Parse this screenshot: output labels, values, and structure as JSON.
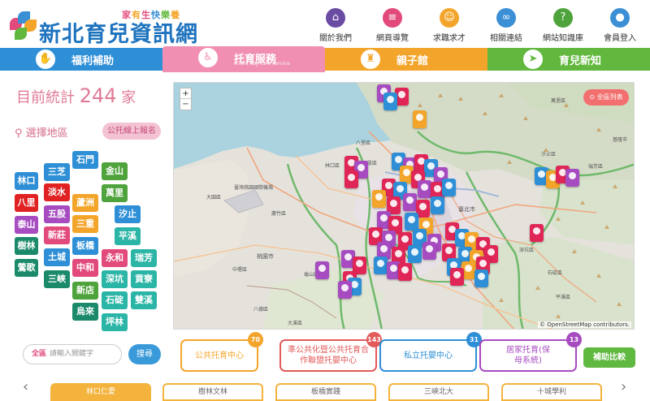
{
  "logo": {
    "title": "新北育兒資訊網",
    "tagline": [
      "家",
      "有",
      "生",
      "快",
      "樂",
      "養"
    ]
  },
  "topnav": [
    {
      "label": "關於我們",
      "icon": "bank-icon",
      "glyph": "⌂",
      "color": "#6a4ca3"
    },
    {
      "label": "網頁導覽",
      "icon": "sitemap-icon",
      "glyph": "≡",
      "color": "#e24a7b"
    },
    {
      "label": "求職求才",
      "icon": "person-icon",
      "glyph": "☺",
      "color": "#f3a52b"
    },
    {
      "label": "相關連結",
      "icon": "link-icon",
      "glyph": "∞",
      "color": "#3a8fd5"
    },
    {
      "label": "網站知識庫",
      "icon": "question-icon",
      "glyph": "?",
      "color": "#4fa33c"
    },
    {
      "label": "會員登入",
      "icon": "user-icon",
      "glyph": "●",
      "color": "#3a8fd5"
    }
  ],
  "mainnav": [
    {
      "label": "福利補助",
      "sub": "",
      "color": "#2e8fd6",
      "icon": "hands-icon",
      "glyph": "✋"
    },
    {
      "label": "托育服務",
      "sub": "Infant day care service",
      "color": "#f08fb1",
      "icon": "stroller-icon",
      "glyph": "♿",
      "active": true
    },
    {
      "label": "親子館",
      "sub": "",
      "color": "#f3a52b",
      "icon": "castle-icon",
      "glyph": "♜"
    },
    {
      "label": "育兒新知",
      "sub": "",
      "color": "#62b83e",
      "icon": "paper-plane-icon",
      "glyph": "➤"
    }
  ],
  "stats": {
    "prefix": "目前統計",
    "count": "244",
    "suffix": "家"
  },
  "region_label": "選擇地區",
  "signup_button": "公托線上報名",
  "districts": [
    {
      "name": "林口",
      "color": "#2e8fd6"
    },
    {
      "name": "三芝",
      "color": "#2e8fd6"
    },
    {
      "name": "石門",
      "color": "#2e8fd6"
    },
    {
      "name": "金山",
      "color": "#4fa33c"
    },
    {
      "name": "八里",
      "color": "#e02222"
    },
    {
      "name": "淡水",
      "color": "#e02222"
    },
    {
      "name": "蘆洲",
      "color": "#f3a52b"
    },
    {
      "name": "萬里",
      "color": "#4fa33c"
    },
    {
      "name": "泰山",
      "color": "#a64bc0"
    },
    {
      "name": "五股",
      "color": "#a64bc0"
    },
    {
      "name": "三重",
      "color": "#f3a52b"
    },
    {
      "name": "汐止",
      "color": "#2e8fd6"
    },
    {
      "name": "新莊",
      "color": "#e24a7b"
    },
    {
      "name": "樹林",
      "color": "#1b8a6b"
    },
    {
      "name": "板橋",
      "color": "#2e8fd6"
    },
    {
      "name": "平溪",
      "color": "#2bb5a6"
    },
    {
      "name": "土城",
      "color": "#2e8fd6"
    },
    {
      "name": "永和",
      "color": "#e24a7b"
    },
    {
      "name": "瑞芳",
      "color": "#2bb5a6"
    },
    {
      "name": "鶯歌",
      "color": "#1b8a6b"
    },
    {
      "name": "中和",
      "color": "#e24a7b"
    },
    {
      "name": "深坑",
      "color": "#2bb5a6"
    },
    {
      "name": "貢寮",
      "color": "#2bb5a6"
    },
    {
      "name": "三峽",
      "color": "#1b8a6b"
    },
    {
      "name": "新店",
      "color": "#4fa33c"
    },
    {
      "name": "石碇",
      "color": "#2bb5a6"
    },
    {
      "name": "雙溪",
      "color": "#2bb5a6"
    },
    {
      "name": "烏來",
      "color": "#1b8a6b"
    },
    {
      "name": "坪林",
      "color": "#2bb5a6"
    }
  ],
  "map": {
    "zoom_in": "+",
    "zoom_out": "−",
    "all_city": "全區列表",
    "attribution": "© OpenStreetMap contributors.",
    "place_labels": [
      "臺灣桃園國際機場",
      "大園區",
      "蘆竹區",
      "八里區",
      "林口區",
      "五股區",
      "臺北市",
      "桃園市",
      "汐止區",
      "深坑區",
      "石碇區",
      "瑞芳區",
      "平溪區",
      "基隆市",
      "萬里區",
      "龜山區",
      "八德區",
      "中壢區",
      "大溪區"
    ]
  },
  "search": {
    "area": "全區",
    "placeholder": "請輸入關鍵字",
    "button": "搜尋"
  },
  "categories": [
    {
      "label": "公共托育中心",
      "count": "70",
      "color": "#f3a52b"
    },
    {
      "label": "準公共化暨公共托育合作聯盟托嬰中心",
      "count": "143",
      "color": "#e25a5a"
    },
    {
      "label": "私立托嬰中心",
      "count": "31",
      "color": "#2e8fd6"
    },
    {
      "label": "居家托育(保母系統)",
      "count": "13",
      "color": "#a64bc0"
    }
  ],
  "compare_button": "補助比較",
  "tabs": [
    "林口仁愛",
    "樹林文林",
    "板橋實踐",
    "三峽北大",
    "十城學利"
  ]
}
